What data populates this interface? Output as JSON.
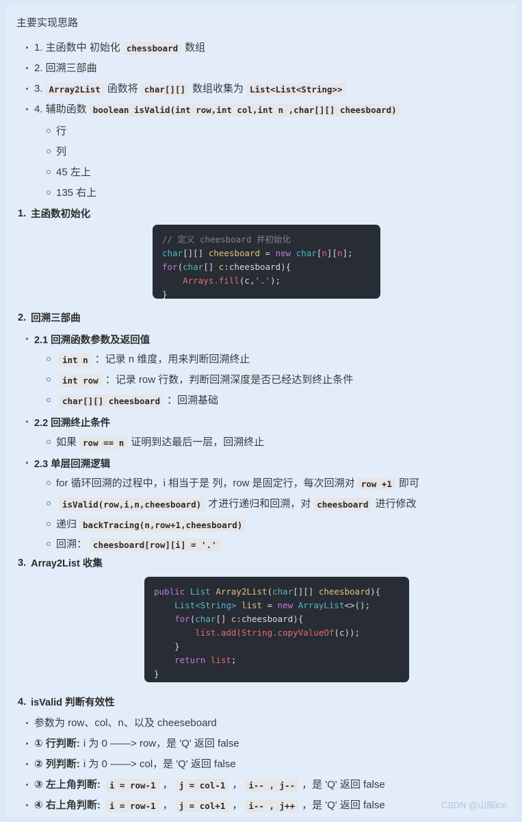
{
  "document": {
    "intro_title": "主要实现思路",
    "watermark": "CSDN @山脚ice"
  },
  "outline": {
    "items": [
      {
        "parts": [
          {
            "type": "text",
            "value": "1. 主函数中 初始化"
          },
          {
            "type": "code",
            "value": "chessboard"
          },
          {
            "type": "text",
            "value": "数组"
          }
        ]
      },
      {
        "parts": [
          {
            "type": "text",
            "value": "2. 回溯三部曲"
          }
        ]
      },
      {
        "parts": [
          {
            "type": "text",
            "value": "3."
          },
          {
            "type": "code",
            "value": "Array2List"
          },
          {
            "type": "text",
            "value": "函数将"
          },
          {
            "type": "code",
            "value": "char[][]"
          },
          {
            "type": "text",
            "value": "数组收集为"
          },
          {
            "type": "code",
            "value": "List<List<String>>"
          }
        ]
      },
      {
        "parts": [
          {
            "type": "text",
            "value": "4. 辅助函数"
          },
          {
            "type": "code",
            "value": "boolean isValid(int  row,int col,int n ,char[][] cheesboard)"
          }
        ]
      }
    ],
    "sub_items": [
      {
        "label": "行"
      },
      {
        "label": "列"
      },
      {
        "label": "45 左上"
      },
      {
        "label": "135 右上"
      }
    ]
  },
  "sections": [
    {
      "number": "1.",
      "title": "主函数初始化"
    },
    {
      "number": "2.",
      "title": "回溯三部曲"
    },
    {
      "number": "3.",
      "title": "Array2List 收集"
    },
    {
      "number": "4.",
      "title": "isValid 判断有效性"
    }
  ],
  "section2": {
    "sub1_title": "2.1 回溯函数参数及返回值",
    "sub1_items": [
      {
        "parts": [
          {
            "type": "code",
            "value": "int n"
          },
          {
            "type": "text",
            "value": "：记录 n 维度，用来判断回溯终止"
          }
        ]
      },
      {
        "parts": [
          {
            "type": "code",
            "value": "int row"
          },
          {
            "type": "text",
            "value": "：记录 row 行数，判断回溯深度是否已经达到终止条件"
          }
        ]
      },
      {
        "parts": [
          {
            "type": "code",
            "value": "char[][] cheesboard"
          },
          {
            "type": "text",
            "value": "：回溯基础"
          }
        ]
      }
    ],
    "sub2_title": "2.2 回溯终止条件",
    "sub2_items": [
      {
        "parts": [
          {
            "type": "text",
            "value": "如果"
          },
          {
            "type": "code",
            "value": "row == n"
          },
          {
            "type": "text",
            "value": "证明到达最后一层，回溯终止"
          }
        ]
      }
    ],
    "sub3_title": "2.3 单层回溯逻辑",
    "sub3_items": [
      {
        "parts": [
          {
            "type": "text",
            "value": "for 循环回溯的过程中，i 相当于是 列，row 是固定行，每次回溯对"
          },
          {
            "type": "code",
            "value": "row +1"
          },
          {
            "type": "text",
            "value": "即可"
          }
        ]
      },
      {
        "parts": [
          {
            "type": "code",
            "value": "isValid(row,i,n,cheesboard)"
          },
          {
            "type": "text",
            "value": "才进行递归和回溯，对"
          },
          {
            "type": "code",
            "value": "cheesboard"
          },
          {
            "type": "text",
            "value": "进行修改"
          }
        ]
      },
      {
        "parts": [
          {
            "type": "text",
            "value": "递归"
          },
          {
            "type": "code",
            "value": "backTracing(n,row+1,cheesboard)"
          }
        ]
      },
      {
        "parts": [
          {
            "type": "text",
            "value": "回溯："
          },
          {
            "type": "code",
            "value": "cheesboard[row][i] = '.'"
          }
        ]
      }
    ]
  },
  "section4": {
    "items": [
      {
        "parts": [
          {
            "type": "text",
            "value": "参数为 row、col、n、以及 cheeseboard"
          }
        ]
      },
      {
        "parts": [
          {
            "type": "bold",
            "value": "① 行判断:"
          },
          {
            "type": "text",
            "value": "i 为 0 ——> row，是 'Q' 返回 false"
          }
        ]
      },
      {
        "parts": [
          {
            "type": "bold",
            "value": "② 列判断:"
          },
          {
            "type": "text",
            "value": "i 为 0 ——> col，是 'Q' 返回 false"
          }
        ]
      },
      {
        "parts": [
          {
            "type": "bold",
            "value": "③ 左上角判断:"
          },
          {
            "type": "code",
            "value": "i = row-1"
          },
          {
            "type": "text",
            "value": "，"
          },
          {
            "type": "code",
            "value": "j = col-1"
          },
          {
            "type": "text",
            "value": "，"
          },
          {
            "type": "code",
            "value": "i-- , j--"
          },
          {
            "type": "text",
            "value": "，是 'Q' 返回 false"
          }
        ]
      },
      {
        "parts": [
          {
            "type": "bold",
            "value": "④ 右上角判断:"
          },
          {
            "type": "code",
            "value": "i = row-1"
          },
          {
            "type": "text",
            "value": "，"
          },
          {
            "type": "code",
            "value": "j = col+1"
          },
          {
            "type": "text",
            "value": "，"
          },
          {
            "type": "code",
            "value": "i-- , j++"
          },
          {
            "type": "text",
            "value": "，是 'Q' 返回 false"
          }
        ]
      }
    ]
  },
  "code_blocks": {
    "block1": {
      "language": "java",
      "lines": [
        [
          {
            "cls": "c-com",
            "t": "// 定义 cheesboard 并初始化"
          }
        ],
        [
          {
            "cls": "c-typ",
            "t": "char"
          },
          {
            "cls": "c-pln",
            "t": "[][] "
          },
          {
            "cls": "c-var",
            "t": "cheesboard"
          },
          {
            "cls": "c-pln",
            "t": " = "
          },
          {
            "cls": "c-key",
            "t": "new"
          },
          {
            "cls": "c-pln",
            "t": " "
          },
          {
            "cls": "c-typ",
            "t": "char"
          },
          {
            "cls": "c-pln",
            "t": "["
          },
          {
            "cls": "c-num",
            "t": "n"
          },
          {
            "cls": "c-pln",
            "t": "]["
          },
          {
            "cls": "c-num",
            "t": "n"
          },
          {
            "cls": "c-pln",
            "t": "];"
          }
        ],
        [
          {
            "cls": "c-key",
            "t": "for"
          },
          {
            "cls": "c-pln",
            "t": "("
          },
          {
            "cls": "c-typ",
            "t": "char"
          },
          {
            "cls": "c-pln",
            "t": "[] "
          },
          {
            "cls": "c-var",
            "t": "c"
          },
          {
            "cls": "c-pln",
            "t": ":cheesboard){"
          }
        ],
        [
          {
            "cls": "c-pln",
            "t": "    "
          },
          {
            "cls": "c-fn",
            "t": "Arrays.fill"
          },
          {
            "cls": "c-pln",
            "t": "(c,"
          },
          {
            "cls": "c-str",
            "t": "'.'"
          },
          {
            "cls": "c-pln",
            "t": ");"
          }
        ],
        [
          {
            "cls": "c-pln",
            "t": "}"
          }
        ]
      ]
    },
    "block2": {
      "language": "java",
      "lines": [
        [
          {
            "cls": "c-key",
            "t": "public"
          },
          {
            "cls": "c-pln",
            "t": " "
          },
          {
            "cls": "c-typ",
            "t": "List"
          },
          {
            "cls": "c-pln",
            "t": " "
          },
          {
            "cls": "c-var",
            "t": "Array2List"
          },
          {
            "cls": "c-pln",
            "t": "("
          },
          {
            "cls": "c-typ",
            "t": "char"
          },
          {
            "cls": "c-pln",
            "t": "[][] "
          },
          {
            "cls": "c-var",
            "t": "cheesboard"
          },
          {
            "cls": "c-pln",
            "t": "){"
          }
        ],
        [
          {
            "cls": "c-pln",
            "t": "    "
          },
          {
            "cls": "c-typ",
            "t": "List<String>"
          },
          {
            "cls": "c-pln",
            "t": " "
          },
          {
            "cls": "c-var",
            "t": "list"
          },
          {
            "cls": "c-pln",
            "t": " = "
          },
          {
            "cls": "c-key",
            "t": "new"
          },
          {
            "cls": "c-pln",
            "t": " "
          },
          {
            "cls": "c-typ",
            "t": "ArrayList"
          },
          {
            "cls": "c-pln",
            "t": "<>();"
          }
        ],
        [
          {
            "cls": "c-pln",
            "t": "    "
          },
          {
            "cls": "c-key",
            "t": "for"
          },
          {
            "cls": "c-pln",
            "t": "("
          },
          {
            "cls": "c-typ",
            "t": "char"
          },
          {
            "cls": "c-pln",
            "t": "[] "
          },
          {
            "cls": "c-var",
            "t": "c"
          },
          {
            "cls": "c-pln",
            "t": ":cheesboard){"
          }
        ],
        [
          {
            "cls": "c-pln",
            "t": "        "
          },
          {
            "cls": "c-fn",
            "t": "list.add(String.copyValueOf"
          },
          {
            "cls": "c-pln",
            "t": "(c));"
          }
        ],
        [
          {
            "cls": "c-pln",
            "t": "    }"
          }
        ],
        [
          {
            "cls": "c-pln",
            "t": "    "
          },
          {
            "cls": "c-key",
            "t": "return"
          },
          {
            "cls": "c-pln",
            "t": " "
          },
          {
            "cls": "c-fn",
            "t": "list"
          },
          {
            "cls": "c-pln",
            "t": ";"
          }
        ],
        [
          {
            "cls": "c-pln",
            "t": "}"
          }
        ]
      ]
    }
  }
}
